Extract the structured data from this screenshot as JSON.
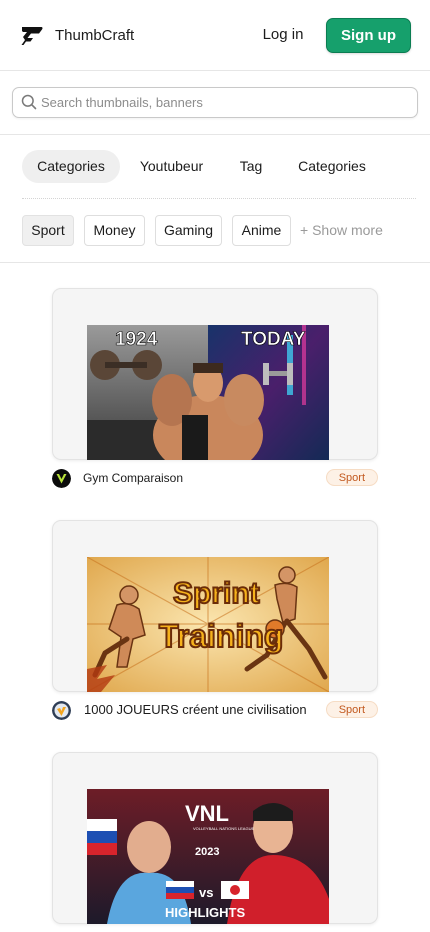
{
  "header": {
    "brand": "ThumbCraft",
    "login_label": "Log in",
    "signup_label": "Sign up",
    "signup_color": "#16a06c"
  },
  "search": {
    "placeholder": "Search thumbnails, banners",
    "value": ""
  },
  "tabs": [
    {
      "label": "Categories",
      "active": true
    },
    {
      "label": "Youtubeur",
      "active": false
    },
    {
      "label": "Tag",
      "active": false
    },
    {
      "label": "Categories",
      "active": false
    }
  ],
  "chips": [
    {
      "label": "Sport",
      "active": true
    },
    {
      "label": "Money",
      "active": false
    },
    {
      "label": "Gaming",
      "active": false
    },
    {
      "label": "Anime",
      "active": false
    }
  ],
  "show_more_label": "+ Show more",
  "cards": [
    {
      "title": "Gym Comparaison",
      "tag": "Sport",
      "thumbnail_texts": [
        "1924",
        "TODAY"
      ],
      "avatar_icon": "v-logo-icon"
    },
    {
      "title": "1000 JOUEURS créent une civilisation",
      "tag": "Sport",
      "thumbnail_texts": [
        "Sprint",
        "Training"
      ],
      "avatar_icon": "shield-avatar-icon"
    },
    {
      "title": "",
      "tag": "",
      "thumbnail_texts": [
        "VNL",
        "VOLLEYBALL NATIONS LEAGUE",
        "2023",
        "vs",
        "HIGHLIGHTS"
      ],
      "avatar_icon": ""
    }
  ],
  "icons": {
    "logo": "thumbcraft-logo-icon",
    "search": "search-icon"
  },
  "colors": {
    "badge_text": "#c2591f",
    "badge_bg": "#fdf1e6"
  }
}
